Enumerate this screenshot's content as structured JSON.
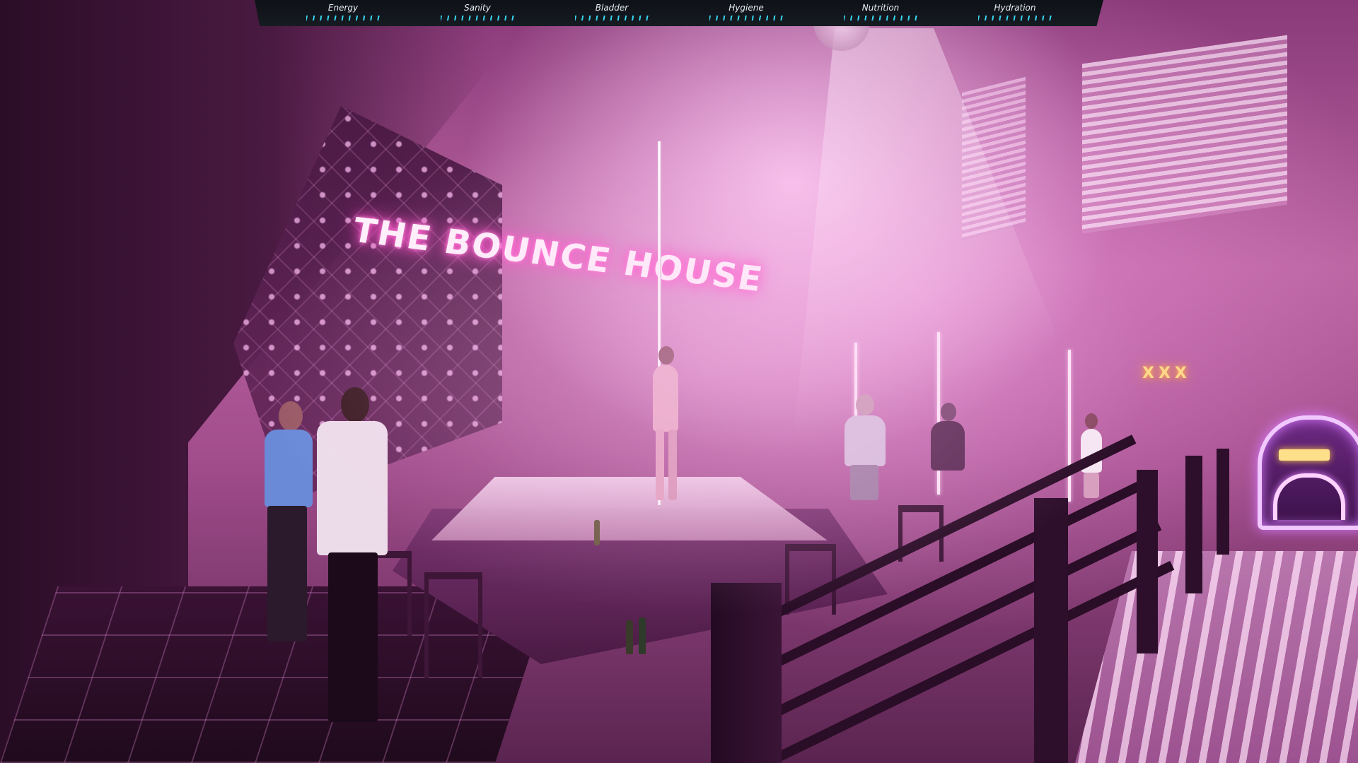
{
  "hud": {
    "stats": [
      {
        "label": "Energy",
        "level": 1.0
      },
      {
        "label": "Sanity",
        "level": 1.0
      },
      {
        "label": "Bladder",
        "level": 1.0
      },
      {
        "label": "Hygiene",
        "level": 1.0
      },
      {
        "label": "Nutrition",
        "level": 1.0
      },
      {
        "label": "Hydration",
        "level": 1.0
      }
    ],
    "bar_color": "#36d4ef"
  },
  "scene": {
    "neon_sign": "THE BOUNCE HOUSE",
    "back_sign": "XXX",
    "accent_color": "#ff4fc8"
  }
}
